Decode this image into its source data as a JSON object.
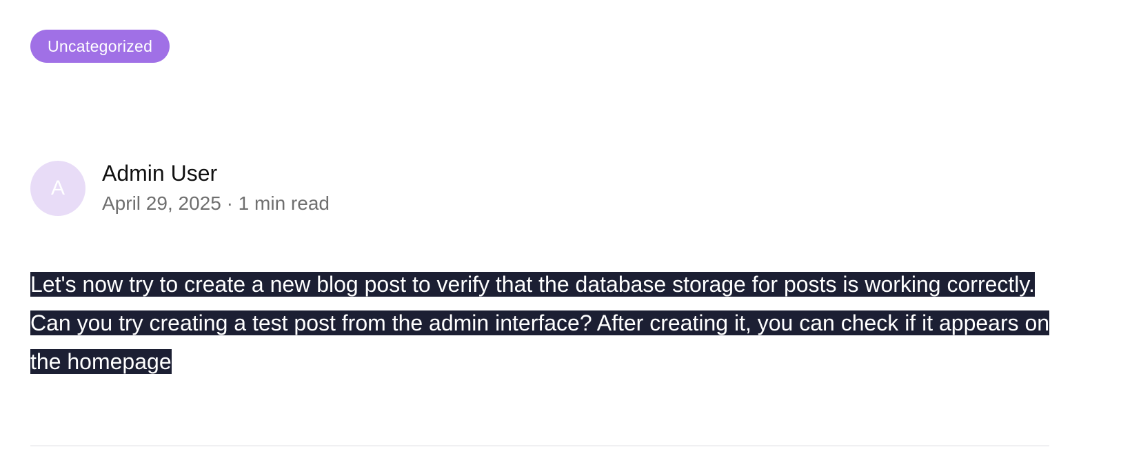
{
  "post": {
    "category": "Uncategorized",
    "author": {
      "avatar_initial": "A",
      "name": "Admin User"
    },
    "meta": "April 29, 2025 · 1 min read",
    "body": "Let's now try to create a new blog post to verify that the database storage for posts is working correctly. Can you try creating a test post from the admin interface? After creating it, you can check if it appears on the homepage"
  },
  "colors": {
    "badge_background": "#a070e6",
    "avatar_background": "#e8dcf7",
    "selection_background": "#1c1f33",
    "meta_text": "#6f6f6f"
  }
}
